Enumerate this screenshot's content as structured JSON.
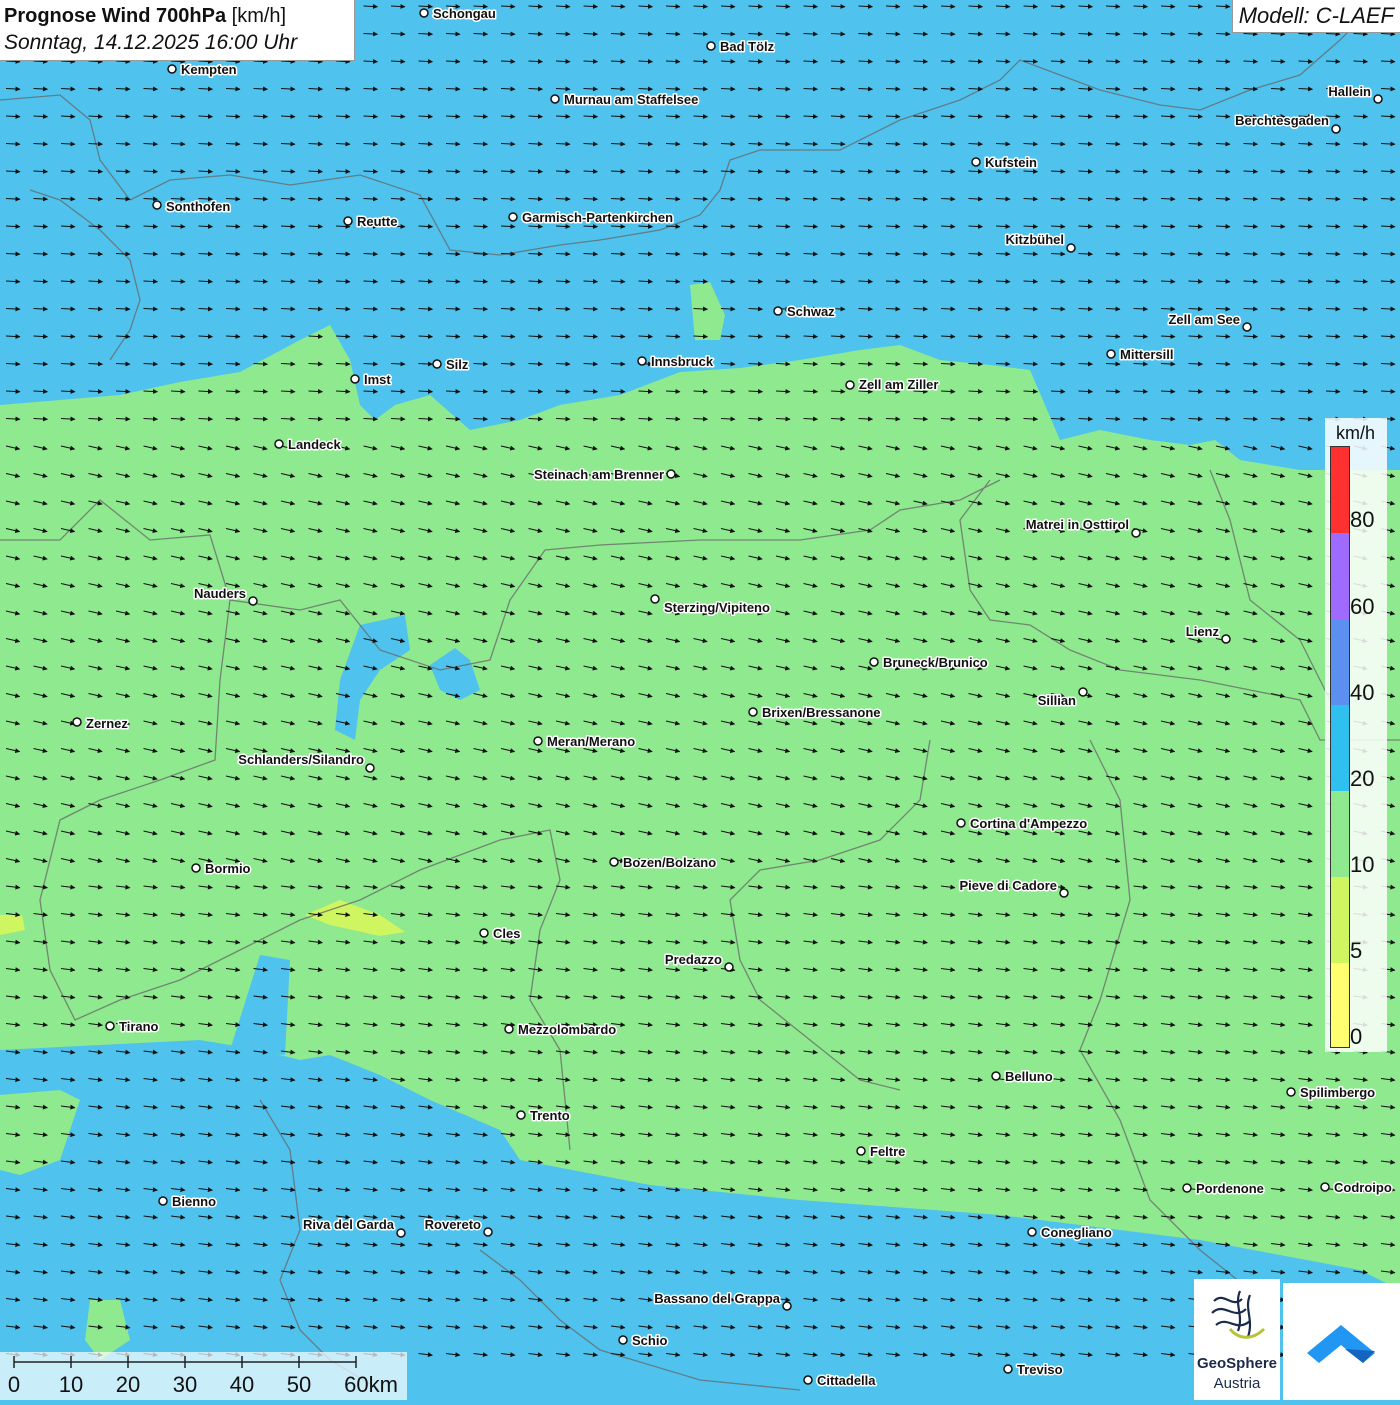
{
  "header": {
    "title_main": "Prognose Wind 700hPa",
    "title_unit": "[km/h]",
    "subtitle": "Sonntag, 14.12.2025 16:00 Uhr"
  },
  "model_label": "Modell: C-LAEF",
  "legend": {
    "unit": "km/h",
    "labels": [
      "80",
      "60",
      "40",
      "20",
      "10",
      "5",
      "0"
    ],
    "colors": [
      "#ff3030",
      "#9f6bff",
      "#5b8ff0",
      "#2fc0ef",
      "#8fe98f",
      "#cff560",
      "#ffff70"
    ]
  },
  "scale_bar": {
    "labels": [
      "0",
      "10",
      "20",
      "30",
      "40",
      "50",
      "60km"
    ]
  },
  "logos": {
    "geosphere_line1": "GeoSphere",
    "geosphere_line2": "Austria"
  },
  "map_colors": {
    "blue_zone": "#4fc3ee",
    "green_zone": "#8fe98f",
    "yellow_zone": "#cff560"
  },
  "cities": [
    "Schongau",
    "Bad Tölz",
    "Kempten",
    "Murnau am Staffelsee",
    "Hallein",
    "Berchtesgaden",
    "Kufstein",
    "Sonthofen",
    "Reutte",
    "Garmisch-Partenkirchen",
    "Kitzbühel",
    "Schwaz",
    "Zell am See",
    "Innsbruck",
    "Silz",
    "Imst",
    "Mittersill",
    "Zell am Ziller",
    "Landeck",
    "Steinach am Brenner",
    "Matrei in Osttirol",
    "Nauders",
    "Sterzing/Vipiteno",
    "Lienz",
    "Bruneck/Brunico",
    "Sillian",
    "Brixen/Bressanone",
    "Zernez",
    "Meran/Merano",
    "Schlanders/Silandro",
    "Cortina d'Ampezzo",
    "Bormio",
    "Bozen/Bolzano",
    "Pieve di Cadore",
    "Cles",
    "Predazzo",
    "Tirano",
    "Mezzolombardo",
    "Belluno",
    "Spilimbergo",
    "Trento",
    "Feltre",
    "Pordenone",
    "Codroipo",
    "Bienno",
    "Riva del Garda",
    "Rovereto",
    "Conegliano",
    "Bassano del Grappa",
    "Schio",
    "Treviso",
    "Cittadella"
  ]
}
